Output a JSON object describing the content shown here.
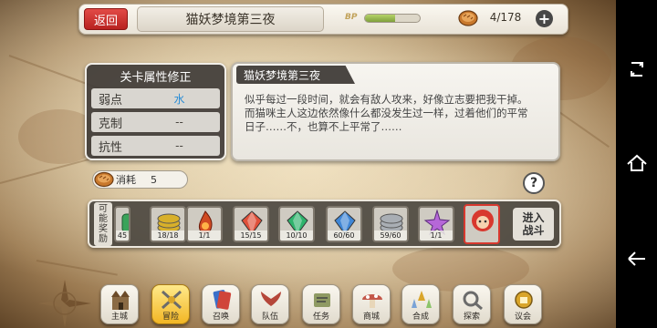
{
  "topbar": {
    "back_label": "返回",
    "stage_title": "猫妖梦境第三夜",
    "bp_label": "BP",
    "bp_fill_fraction": 0.55,
    "stamina_text": "4/178",
    "plus_label": "+"
  },
  "attributes": {
    "header": "关卡属性修正",
    "rows": [
      {
        "name": "弱点",
        "value": "水"
      },
      {
        "name": "克制",
        "value": "--"
      },
      {
        "name": "抗性",
        "value": "--"
      }
    ]
  },
  "description": {
    "title": "猫妖梦境第三夜",
    "line1": "似乎每过一段时间，就会有敌人攻来，好像立志要把我干掉。",
    "line2": "而猫咪主人这边依然像什么都没发生过一样，过着他们的平常",
    "line3": "日子……不，也算不上平常了……"
  },
  "consume": {
    "label": "消耗",
    "value": "5"
  },
  "help_label": "?",
  "rewards": {
    "label_chars": [
      "可",
      "能",
      "奖",
      "励"
    ],
    "items": [
      {
        "icon": "green-item-icon",
        "count": "45",
        "color": "#3aa35a"
      },
      {
        "icon": "gold-coins-icon",
        "count": "18/18",
        "color": "#d8b02a"
      },
      {
        "icon": "red-flame-icon",
        "count": "1/1",
        "color": "#d04a22"
      },
      {
        "icon": "red-crystal-icon",
        "count": "15/15",
        "color": "#e0503a"
      },
      {
        "icon": "green-crystal-icon",
        "count": "10/10",
        "color": "#2fb36c"
      },
      {
        "icon": "blue-crystal-icon",
        "count": "60/60",
        "color": "#3f86d6"
      },
      {
        "icon": "silver-coins-icon",
        "count": "59/60",
        "color": "#a9aeb4"
      },
      {
        "icon": "rainbow-star-icon",
        "count": "1/1",
        "color": "#b667d8"
      },
      {
        "icon": "character-portrait-icon",
        "count": "",
        "color": "#d8382e"
      }
    ]
  },
  "enter_battle": {
    "line1": "进入",
    "line2": "战斗"
  },
  "bottom_nav": [
    {
      "label": "主城",
      "icon": "castle-icon",
      "active": false
    },
    {
      "label": "冒险",
      "icon": "crossed-swords-icon",
      "active": true
    },
    {
      "label": "召唤",
      "icon": "summon-cards-icon",
      "active": false
    },
    {
      "label": "队伍",
      "icon": "team-wings-icon",
      "active": false
    },
    {
      "label": "任务",
      "icon": "quest-scroll-icon",
      "active": false
    },
    {
      "label": "商城",
      "icon": "shop-mushroom-icon",
      "active": false
    },
    {
      "label": "合成",
      "icon": "synthesis-icon",
      "active": false
    },
    {
      "label": "探索",
      "icon": "explore-icon",
      "active": false
    },
    {
      "label": "议会",
      "icon": "council-icon",
      "active": false
    }
  ],
  "colors": {
    "back_button": "#c8302c",
    "bp_fill": "#8db04a",
    "active_nav": "#f2c030",
    "water": "#2a8dd6"
  }
}
